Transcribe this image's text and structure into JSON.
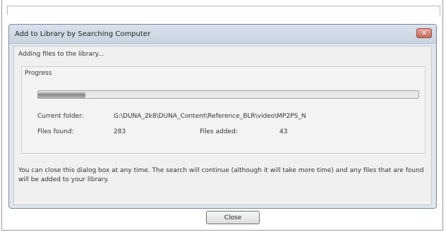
{
  "dialog": {
    "title": "Add to Library by Searching Computer",
    "close_glyph": "✕",
    "status_text": "Adding files to the library...",
    "progress_group_label": "Progress",
    "progress_fraction": 0.125,
    "current_folder_label": "Current folder:",
    "current_folder_value": "G:\\DUNA_2k8\\DUNA_Content\\Reference_BLR\\video\\MP2PS_N",
    "files_found_label": "Files found:",
    "files_found_value": "283",
    "files_added_label": "Files added:",
    "files_added_value": "43",
    "info_text": "You can close this dialog box at any time. The search will continue (although it will take more time) and any files that are found will be added to your library.",
    "close_button_label": "Close"
  }
}
